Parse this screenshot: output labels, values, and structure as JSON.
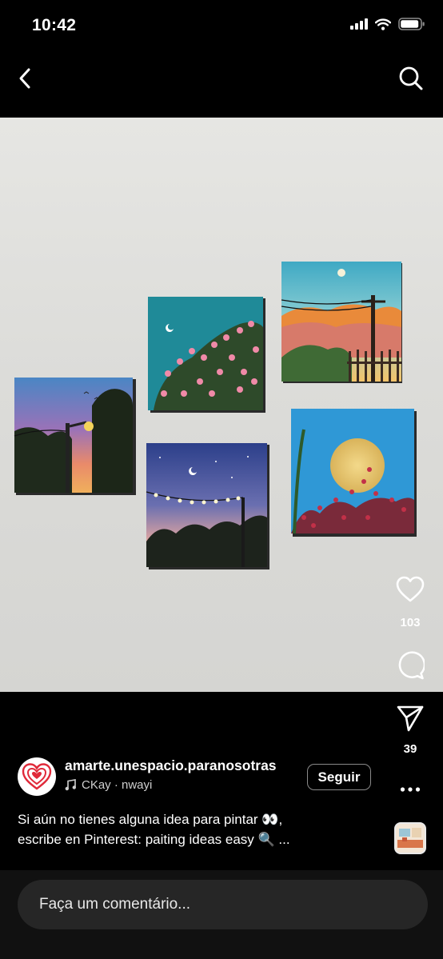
{
  "status_bar": {
    "time": "10:42"
  },
  "nav": {
    "back_icon": "chevron-left-icon",
    "search_icon": "search-icon"
  },
  "actions": {
    "like_count": "103",
    "share_count": "39"
  },
  "post": {
    "username": "amarte.unespacio.paranosotras",
    "audio_text": "CKay · nwayi",
    "follow_label": "Seguir",
    "caption_line_1": "Si aún no tienes alguna idea para pintar 👀,",
    "caption_line_2": "escribe en Pinterest: paiting ideas easy 🔍 ..."
  },
  "comment": {
    "placeholder": "Faça um comentário..."
  },
  "colors": {
    "background": "#000000",
    "input_bg": "#262626",
    "icon": "#ffffff",
    "avatar_heart": "#e02a3a"
  }
}
